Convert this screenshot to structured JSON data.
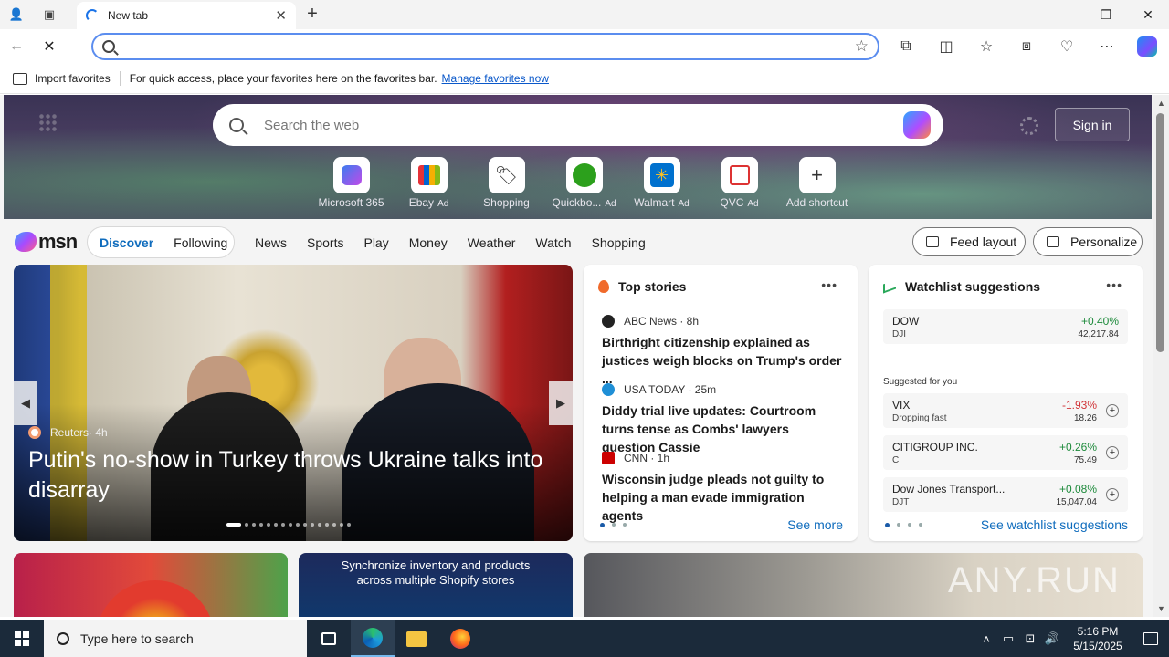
{
  "browser": {
    "tab_title": "New tab",
    "new_tab_symbol": "+",
    "window_controls": {
      "minimize": "—",
      "maximize": "❐",
      "close": "✕"
    },
    "address_value": "",
    "favorites_bar": {
      "import_label": "Import favorites",
      "message": "For quick access, place your favorites here on the favorites bar.",
      "manage_link": "Manage favorites now"
    }
  },
  "hero": {
    "search_placeholder": "Search the web",
    "sign_in": "Sign in",
    "shortcuts": [
      {
        "label": "Microsoft 365",
        "ad": ""
      },
      {
        "label": "Ebay",
        "ad": "Ad"
      },
      {
        "label": "Shopping",
        "ad": ""
      },
      {
        "label": "Quickbo...",
        "ad": "Ad"
      },
      {
        "label": "Walmart",
        "ad": "Ad"
      },
      {
        "label": "QVC",
        "ad": "Ad"
      },
      {
        "label": "Add shortcut",
        "ad": ""
      }
    ]
  },
  "msn": {
    "logo": "msn",
    "tabs": {
      "discover": "Discover",
      "following": "Following"
    },
    "nav": [
      "News",
      "Sports",
      "Play",
      "Money",
      "Weather",
      "Watch",
      "Shopping"
    ],
    "feed_layout": "Feed layout",
    "personalize": "Personalize"
  },
  "main_story": {
    "source": "Reuters",
    "age": " · 4h",
    "title": "Putin's no-show in Turkey throws Ukraine talks into disarray"
  },
  "top_stories": {
    "heading": "Top stories",
    "items": [
      {
        "source": "ABC News · 8h",
        "title": "Birthright citizenship explained as justices weigh blocks on Trump's order ..."
      },
      {
        "source": "USA TODAY · 25m",
        "title": "Diddy trial live updates: Courtroom turns tense as Combs' lawyers question Cassie"
      },
      {
        "source": "CNN · 1h",
        "title": "Wisconsin judge pleads not guilty to helping a man evade immigration agents"
      }
    ],
    "see_more": "See more"
  },
  "watchlist": {
    "heading": "Watchlist suggestions",
    "suggested_label": "Suggested for you",
    "rows": [
      {
        "name": "DOW",
        "ticker": "DJI",
        "change": "+0.40%",
        "price": "42,217.84"
      },
      {
        "name": "VIX",
        "ticker": "Dropping fast",
        "change": "-1.93%",
        "price": "18.26"
      },
      {
        "name": "CITIGROUP INC.",
        "ticker": "C",
        "change": "+0.26%",
        "price": "75.49"
      },
      {
        "name": "Dow Jones Transport...",
        "ticker": "DJT",
        "change": "+0.08%",
        "price": "15,047.04"
      }
    ],
    "see_link": "See watchlist suggestions"
  },
  "promo": {
    "shopify_text": "Synchronize inventory and products across multiple Shopify stores",
    "watermark": "ANY.RUN"
  },
  "taskbar": {
    "search_placeholder": "Type here to search",
    "time": "5:16 PM",
    "date": "5/15/2025"
  },
  "colors": {
    "accent": "#0f6cbd",
    "up": "#1d8a3b",
    "down": "#d13438",
    "taskbar": "#1b2a3a"
  }
}
